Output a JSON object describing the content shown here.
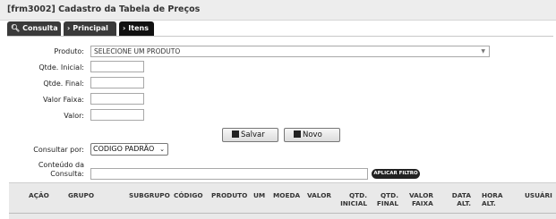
{
  "window": {
    "title": "[frm3002] Cadastro da Tabela de Preços"
  },
  "tabs": [
    {
      "label": "Consulta",
      "icon": "search-icon"
    },
    {
      "label": "Principal",
      "icon": "chevron-right-icon"
    },
    {
      "label": "Itens",
      "icon": "chevron-right-icon",
      "active": true
    }
  ],
  "form": {
    "produto_label": "Produto:",
    "produto_value": "SELECIONE UM PRODUTO",
    "qtde_inicial_label": "Qtde. Inicial:",
    "qtde_final_label": "Qtde. Final:",
    "valor_faixa_label": "Valor Faixa:",
    "valor_label": "Valor:"
  },
  "actions": {
    "save_label": "Salvar",
    "new_label": "Novo"
  },
  "search": {
    "consultar_label": "Consultar por:",
    "consultar_value": "CODIGO PADRÃO",
    "conteudo_label_1": "Conteúdo da",
    "conteudo_label_2": "Consulta:",
    "filter_button": "APLICAR FILTRO"
  },
  "table": {
    "headers": [
      "AÇÃO",
      "GRUPO",
      "SUBGRUPO",
      "CÓDIGO",
      "PRODUTO",
      "UM",
      "MOEDA",
      "VALOR",
      "QTD. INICIAL",
      "QTD. FINAL",
      "VALOR FAIXA",
      "DATA ALT.",
      "HORA ALT.",
      "USUÁRI"
    ],
    "h_qtd_inicial_1": "QTD.",
    "h_qtd_inicial_2": "INICIAL",
    "h_qtd_final_1": "QTD.",
    "h_qtd_final_2": "FINAL",
    "h_valor_faixa_1": "VALOR",
    "h_valor_faixa_2": "FAIXA",
    "h_data_1": "DATA",
    "h_data_2": "ALT.",
    "h_hora_1": "HORA",
    "h_hora_2": "ALT."
  }
}
